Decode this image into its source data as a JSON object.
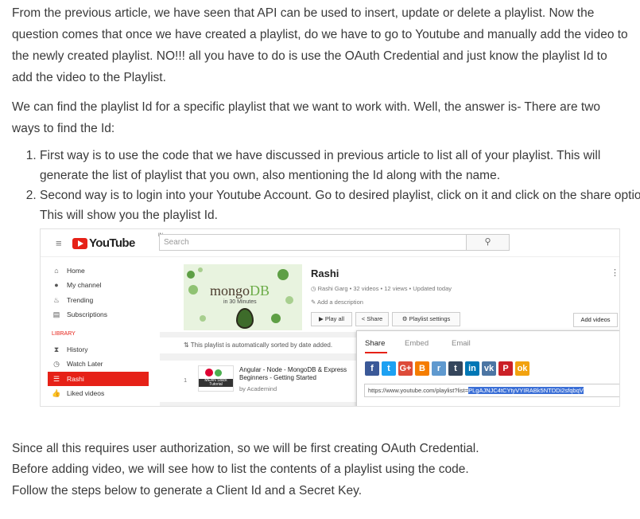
{
  "article": {
    "para1": "From the previous article, we have seen that API can be used to insert, update or delete a playlist. Now the question comes that once we have created a playlist, do we have to go to Youtube and manually add the video to the newly created playlist. NO!!! all you have to do is use the OAuth Credential and just know the playlist Id to add the video to the Playlist.",
    "para2": "We can find the playlist Id for a specific playlist that we want to work with. Well, the answer is- There are two ways to find the Id:",
    "steps": [
      "First way is to use the code that we have discussed in previous article to list all of your playlist. This will generate the list of playlist that you own, also mentioning the Id along with the name.",
      "Second way is to login into your Youtube Account. Go to desired playlist, click on it and click on the share option. This will show you the playlist Id."
    ],
    "para3": "Since all this requires user authorization, so we will be first creating OAuth Credential.",
    "para4": "Before adding video, we will see how to list the contents of a playlist using the code.",
    "para5": "Follow the steps below to generate a Client Id and a Secret Key."
  },
  "screenshot": {
    "logo_text": "YouTube",
    "logo_region": "IN",
    "search_placeholder": "Search",
    "sidebar": [
      {
        "icon": "home-icon",
        "glyph": "⌂",
        "label": "Home"
      },
      {
        "icon": "account-icon",
        "glyph": "●",
        "label": "My channel"
      },
      {
        "icon": "flame-icon",
        "glyph": "♨",
        "label": "Trending"
      },
      {
        "icon": "subscriptions-icon",
        "glyph": "▤",
        "label": "Subscriptions"
      }
    ],
    "library_label": "LIBRARY",
    "library": [
      {
        "icon": "history-icon",
        "glyph": "⧗",
        "label": "History"
      },
      {
        "icon": "clock-icon",
        "glyph": "◷",
        "label": "Watch Later"
      },
      {
        "icon": "playlist-icon",
        "glyph": "☰",
        "label": "Rashi"
      },
      {
        "icon": "thumbs-up-icon",
        "glyph": "👍",
        "label": "Liked videos"
      }
    ],
    "thumb_brand": "mongo",
    "thumb_brand2": "DB",
    "thumb_sub": "in 30 Minutes",
    "playlist_title": "Rashi",
    "playlist_meta": "Rashi Garg • 32 videos • 12 views • Updated today",
    "add_description": "Add a description",
    "play_all": "Play all",
    "share_label": "Share",
    "playlist_settings": "Playlist settings",
    "add_videos": "Add videos",
    "sorted_note": "This playlist is automatically sorted by date added.",
    "video": {
      "index": "1",
      "thumb_caption": "MEAN Stack Tutorial",
      "title": "Angular - Node - MongoDB & Express Beginners - Getting Started",
      "channel": "by Academind"
    },
    "share_tabs": [
      "Share",
      "Embed",
      "Email"
    ],
    "share_icons": [
      {
        "name": "facebook-icon",
        "glyph": "f",
        "color": "#3b5998"
      },
      {
        "name": "twitter-icon",
        "glyph": "t",
        "color": "#1da1f2"
      },
      {
        "name": "google-plus-icon",
        "glyph": "G+",
        "color": "#dd4b39"
      },
      {
        "name": "blogger-icon",
        "glyph": "B",
        "color": "#f57d00"
      },
      {
        "name": "reddit-icon",
        "glyph": "r",
        "color": "#5f99cf"
      },
      {
        "name": "tumblr-icon",
        "glyph": "t",
        "color": "#35465c"
      },
      {
        "name": "linkedin-icon",
        "glyph": "in",
        "color": "#0077b5"
      },
      {
        "name": "vk-icon",
        "glyph": "vk",
        "color": "#4c75a3"
      },
      {
        "name": "pinterest-icon",
        "glyph": "P",
        "color": "#cb2027"
      },
      {
        "name": "odnoklassniki-icon",
        "glyph": "ok",
        "color": "#f2a20f"
      }
    ],
    "share_url_prefix": "https://www.youtube.com/playlist?list=",
    "share_url_id": "PLgAJNJC4tCYtyVYIRABk5NTDDi2sfqbqV"
  }
}
